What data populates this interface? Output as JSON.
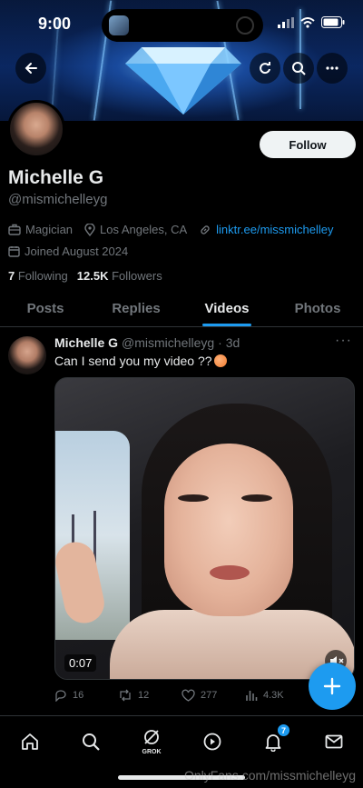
{
  "status_bar": {
    "time": "9:00"
  },
  "profile": {
    "name": "Michelle G",
    "handle": "@mismichelleyg",
    "follow_label": "Follow",
    "profession": "Magician",
    "location": "Los Angeles, CA",
    "link": "linktr.ee/missmichelley",
    "joined": "Joined August 2024",
    "following_count": "7",
    "following_label": "Following",
    "followers_count": "12.5K",
    "followers_label": "Followers"
  },
  "tabs": [
    {
      "label": "Posts",
      "active": false
    },
    {
      "label": "Replies",
      "active": false
    },
    {
      "label": "Videos",
      "active": true
    },
    {
      "label": "Photos",
      "active": false
    }
  ],
  "post": {
    "author": "Michelle G",
    "handle": "@mismichelleyg",
    "age": "· 3d",
    "text": "Can I send you my video ??",
    "duration": "0:07",
    "replies": "16",
    "reposts": "12",
    "likes": "277",
    "views": "4.3K"
  },
  "bottom_nav": {
    "grok_label": "GROK",
    "notifications_badge": "7"
  },
  "watermark": "OnlyFans.com/missmichelleyg",
  "colors": {
    "accent": "#1d9bf0",
    "background": "#000000",
    "muted_text": "#71767b"
  },
  "icons": [
    "back-arrow-icon",
    "refresh-icon",
    "search-icon",
    "more-icon",
    "briefcase-icon",
    "location-pin-icon",
    "link-icon",
    "calendar-icon",
    "reply-icon",
    "repost-icon",
    "like-icon",
    "views-icon",
    "compose-plus-icon",
    "home-icon",
    "grok-icon",
    "video-play-icon",
    "bell-icon",
    "mail-icon",
    "mute-icon"
  ]
}
